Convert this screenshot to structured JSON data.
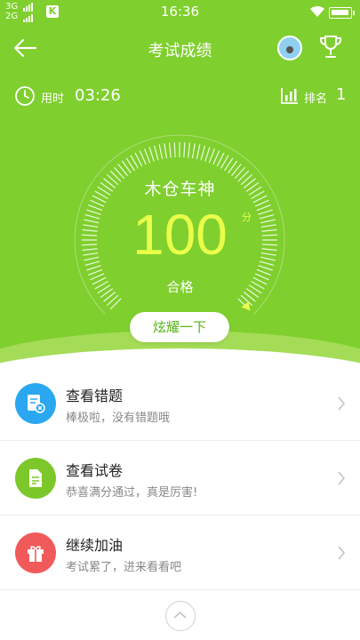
{
  "status_bar": {
    "time": "16:36",
    "network_1": "3G",
    "network_2": "2G",
    "app_badge": "K"
  },
  "header": {
    "title": "考试成绩"
  },
  "stats": {
    "time_label": "用时",
    "time_value": "03:26",
    "rank_label": "排名",
    "rank_value": "1"
  },
  "result": {
    "player_name": "木仓车神",
    "score": "100",
    "score_unit": "分",
    "grade": "合格",
    "share_button": "炫耀一下"
  },
  "menu": [
    {
      "title": "查看错题",
      "subtitle": "棒极啦，没有错题哦",
      "icon": "wrong-answers-icon",
      "color": "#2aa7f0"
    },
    {
      "title": "查看试卷",
      "subtitle": "恭喜满分通过，真是厉害!",
      "icon": "exam-paper-icon",
      "color": "#7cc72a"
    },
    {
      "title": "继续加油",
      "subtitle": "考试累了，进来看看吧",
      "icon": "gift-icon",
      "color": "#f15a5a"
    }
  ],
  "colors": {
    "header_green": "#7fcf2e",
    "score_yellow": "#e9ff4a"
  }
}
